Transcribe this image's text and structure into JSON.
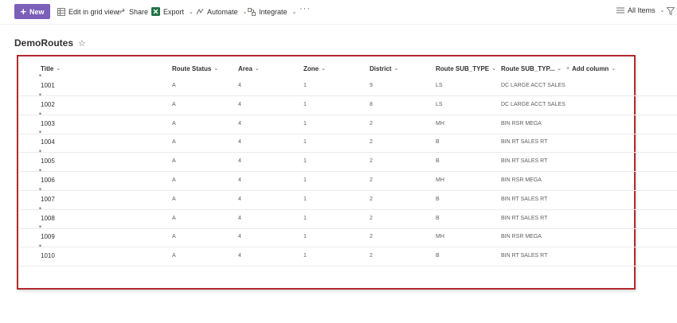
{
  "toolbar": {
    "new_label": "New",
    "edit_grid_label": "Edit in grid view",
    "share_label": "Share",
    "export_label": "Export",
    "automate_label": "Automate",
    "integrate_label": "Integrate",
    "more_label": "···",
    "view_label": "All Items"
  },
  "list": {
    "title": "DemoRoutes",
    "columns": [
      "Title",
      "Route Status",
      "Area",
      "Zone",
      "District",
      "Route SUB_TYPE",
      "Route SUB_TYP...",
      "Add column"
    ],
    "rows": [
      {
        "title": "1001",
        "status": "A",
        "area": "4",
        "zone": "1",
        "district": "9",
        "subtype": "LS",
        "subtype_desc": "DC LARGE ACCT SALES"
      },
      {
        "title": "1002",
        "status": "A",
        "area": "4",
        "zone": "1",
        "district": "8",
        "subtype": "LS",
        "subtype_desc": "DC LARGE ACCT SALES"
      },
      {
        "title": "1003",
        "status": "A",
        "area": "4",
        "zone": "1",
        "district": "2",
        "subtype": "MH",
        "subtype_desc": "BIN RSR MEGA"
      },
      {
        "title": "1004",
        "status": "A",
        "area": "4",
        "zone": "1",
        "district": "2",
        "subtype": "B",
        "subtype_desc": "BIN RT SALES RT"
      },
      {
        "title": "1005",
        "status": "A",
        "area": "4",
        "zone": "1",
        "district": "2",
        "subtype": "B",
        "subtype_desc": "BIN RT SALES RT"
      },
      {
        "title": "1006",
        "status": "A",
        "area": "4",
        "zone": "1",
        "district": "2",
        "subtype": "MH",
        "subtype_desc": "BIN RSR MEGA"
      },
      {
        "title": "1007",
        "status": "A",
        "area": "4",
        "zone": "1",
        "district": "2",
        "subtype": "B",
        "subtype_desc": "BIN RT SALES RT"
      },
      {
        "title": "1008",
        "status": "A",
        "area": "4",
        "zone": "1",
        "district": "2",
        "subtype": "B",
        "subtype_desc": "BIN RT SALES RT"
      },
      {
        "title": "1009",
        "status": "A",
        "area": "4",
        "zone": "1",
        "district": "2",
        "subtype": "MH",
        "subtype_desc": "BIN RSR MEGA"
      },
      {
        "title": "1010",
        "status": "A",
        "area": "4",
        "zone": "1",
        "district": "2",
        "subtype": "B",
        "subtype_desc": "BIN RT SALES RT"
      }
    ]
  },
  "colors": {
    "accent": "#7b5fb9",
    "highlight_border": "#b22a2e",
    "excel_green": "#217346"
  },
  "icons": [
    "plus-icon",
    "grid-view-icon",
    "share-icon",
    "excel-icon",
    "automate-icon",
    "integrate-icon",
    "view-list-icon",
    "filter-icon",
    "star-icon",
    "new-item-icon"
  ]
}
